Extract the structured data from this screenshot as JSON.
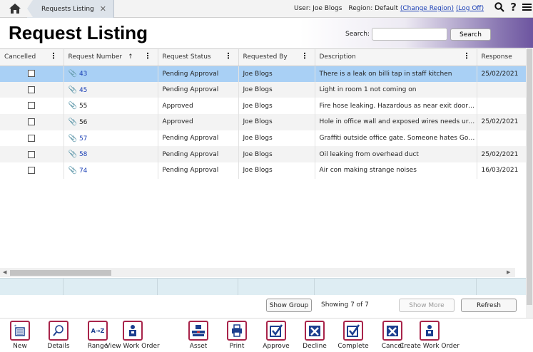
{
  "topbar": {
    "tab_label": "Requests Listing",
    "user_text": "User: Joe Blogs",
    "region_text": "Region: Default",
    "change_region": "(Change Region)",
    "log_off": "(Log Off)"
  },
  "page": {
    "title": "Request Listing"
  },
  "search": {
    "label": "Search:",
    "value": "",
    "button": "Search"
  },
  "grid": {
    "columns": [
      "Cancelled",
      "Request Number",
      "Request Status",
      "Requested By",
      "Description",
      "Response"
    ],
    "rows": [
      {
        "number": "43",
        "linked": true,
        "status": "Pending Approval",
        "by": "Joe Blogs",
        "description": "There is a leak on billi tap in staff kitchen",
        "response": "25/02/2021",
        "selected": true
      },
      {
        "number": "45",
        "linked": true,
        "status": "Pending Approval",
        "by": "Joe Blogs",
        "description": "Light in room 1 not coming on",
        "response": ""
      },
      {
        "number": "55",
        "linked": false,
        "status": "Approved",
        "by": "Joe Blogs",
        "description": "Fire hose leaking. Hazardous as near exit door i...",
        "response": ""
      },
      {
        "number": "56",
        "linked": false,
        "status": "Approved",
        "by": "Joe Blogs",
        "description": "Hole in office wall and exposed wires needs urg...",
        "response": "25/02/2021"
      },
      {
        "number": "57",
        "linked": true,
        "status": "Pending Approval",
        "by": "Joe Blogs",
        "description": "Graffiti outside office gate. Someone hates Goo...",
        "response": ""
      },
      {
        "number": "58",
        "linked": true,
        "status": "Pending Approval",
        "by": "Joe Blogs",
        "description": "Oil leaking from overhead duct",
        "response": "25/02/2021"
      },
      {
        "number": "74",
        "linked": true,
        "status": "Pending Approval",
        "by": "Joe Blogs",
        "description": "Air con making strange noises",
        "response": "16/03/2021"
      }
    ]
  },
  "pager": {
    "show_group": "Show Group",
    "showing": "Showing 7 of 7",
    "show_more": "Show More",
    "refresh": "Refresh"
  },
  "toolbar": {
    "items": [
      {
        "label": "New",
        "icon": "new-doc-icon"
      },
      {
        "label": "Details",
        "icon": "magnifier-icon"
      },
      {
        "label": "Range",
        "icon": "sort-az-icon",
        "icon_text": "A→Z"
      },
      {
        "label": "View Work Order",
        "icon": "worker-icon"
      },
      {
        "label": "Asset",
        "icon": "asset-icon"
      },
      {
        "label": "Print",
        "icon": "printer-icon"
      },
      {
        "label": "Approve",
        "icon": "check-icon"
      },
      {
        "label": "Decline",
        "icon": "x-icon"
      },
      {
        "label": "Complete",
        "icon": "check-icon"
      },
      {
        "label": "Cancel",
        "icon": "x-icon"
      },
      {
        "label": "Create Work Order",
        "icon": "worker-icon"
      }
    ]
  },
  "colors": {
    "accent": "#a8244a",
    "selected_row": "#a9d0f5",
    "link": "#1a3fb5",
    "header_gradient": "#6d55a0"
  }
}
